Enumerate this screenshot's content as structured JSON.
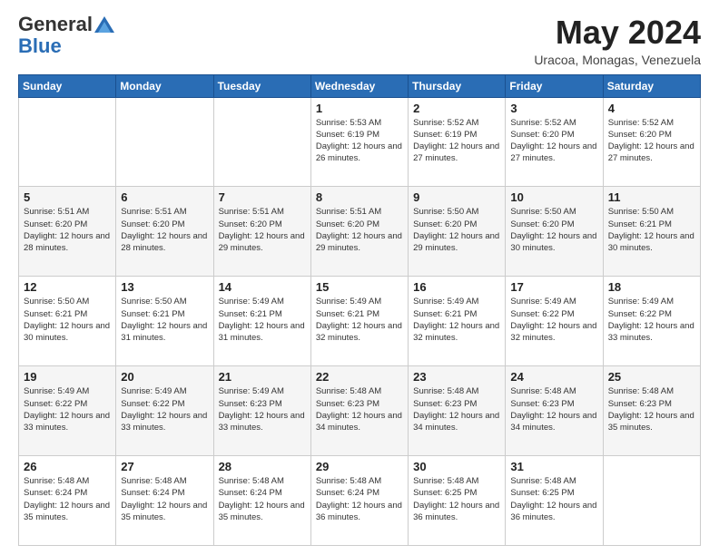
{
  "logo": {
    "general": "General",
    "blue": "Blue"
  },
  "title": {
    "month_year": "May 2024",
    "location": "Uracoa, Monagas, Venezuela"
  },
  "weekdays": [
    "Sunday",
    "Monday",
    "Tuesday",
    "Wednesday",
    "Thursday",
    "Friday",
    "Saturday"
  ],
  "weeks": [
    [
      {
        "day": "",
        "info": ""
      },
      {
        "day": "",
        "info": ""
      },
      {
        "day": "",
        "info": ""
      },
      {
        "day": "1",
        "info": "Sunrise: 5:53 AM\nSunset: 6:19 PM\nDaylight: 12 hours and 26 minutes."
      },
      {
        "day": "2",
        "info": "Sunrise: 5:52 AM\nSunset: 6:19 PM\nDaylight: 12 hours and 27 minutes."
      },
      {
        "day": "3",
        "info": "Sunrise: 5:52 AM\nSunset: 6:20 PM\nDaylight: 12 hours and 27 minutes."
      },
      {
        "day": "4",
        "info": "Sunrise: 5:52 AM\nSunset: 6:20 PM\nDaylight: 12 hours and 27 minutes."
      }
    ],
    [
      {
        "day": "5",
        "info": "Sunrise: 5:51 AM\nSunset: 6:20 PM\nDaylight: 12 hours and 28 minutes."
      },
      {
        "day": "6",
        "info": "Sunrise: 5:51 AM\nSunset: 6:20 PM\nDaylight: 12 hours and 28 minutes."
      },
      {
        "day": "7",
        "info": "Sunrise: 5:51 AM\nSunset: 6:20 PM\nDaylight: 12 hours and 29 minutes."
      },
      {
        "day": "8",
        "info": "Sunrise: 5:51 AM\nSunset: 6:20 PM\nDaylight: 12 hours and 29 minutes."
      },
      {
        "day": "9",
        "info": "Sunrise: 5:50 AM\nSunset: 6:20 PM\nDaylight: 12 hours and 29 minutes."
      },
      {
        "day": "10",
        "info": "Sunrise: 5:50 AM\nSunset: 6:20 PM\nDaylight: 12 hours and 30 minutes."
      },
      {
        "day": "11",
        "info": "Sunrise: 5:50 AM\nSunset: 6:21 PM\nDaylight: 12 hours and 30 minutes."
      }
    ],
    [
      {
        "day": "12",
        "info": "Sunrise: 5:50 AM\nSunset: 6:21 PM\nDaylight: 12 hours and 30 minutes."
      },
      {
        "day": "13",
        "info": "Sunrise: 5:50 AM\nSunset: 6:21 PM\nDaylight: 12 hours and 31 minutes."
      },
      {
        "day": "14",
        "info": "Sunrise: 5:49 AM\nSunset: 6:21 PM\nDaylight: 12 hours and 31 minutes."
      },
      {
        "day": "15",
        "info": "Sunrise: 5:49 AM\nSunset: 6:21 PM\nDaylight: 12 hours and 32 minutes."
      },
      {
        "day": "16",
        "info": "Sunrise: 5:49 AM\nSunset: 6:21 PM\nDaylight: 12 hours and 32 minutes."
      },
      {
        "day": "17",
        "info": "Sunrise: 5:49 AM\nSunset: 6:22 PM\nDaylight: 12 hours and 32 minutes."
      },
      {
        "day": "18",
        "info": "Sunrise: 5:49 AM\nSunset: 6:22 PM\nDaylight: 12 hours and 33 minutes."
      }
    ],
    [
      {
        "day": "19",
        "info": "Sunrise: 5:49 AM\nSunset: 6:22 PM\nDaylight: 12 hours and 33 minutes."
      },
      {
        "day": "20",
        "info": "Sunrise: 5:49 AM\nSunset: 6:22 PM\nDaylight: 12 hours and 33 minutes."
      },
      {
        "day": "21",
        "info": "Sunrise: 5:49 AM\nSunset: 6:23 PM\nDaylight: 12 hours and 33 minutes."
      },
      {
        "day": "22",
        "info": "Sunrise: 5:48 AM\nSunset: 6:23 PM\nDaylight: 12 hours and 34 minutes."
      },
      {
        "day": "23",
        "info": "Sunrise: 5:48 AM\nSunset: 6:23 PM\nDaylight: 12 hours and 34 minutes."
      },
      {
        "day": "24",
        "info": "Sunrise: 5:48 AM\nSunset: 6:23 PM\nDaylight: 12 hours and 34 minutes."
      },
      {
        "day": "25",
        "info": "Sunrise: 5:48 AM\nSunset: 6:23 PM\nDaylight: 12 hours and 35 minutes."
      }
    ],
    [
      {
        "day": "26",
        "info": "Sunrise: 5:48 AM\nSunset: 6:24 PM\nDaylight: 12 hours and 35 minutes."
      },
      {
        "day": "27",
        "info": "Sunrise: 5:48 AM\nSunset: 6:24 PM\nDaylight: 12 hours and 35 minutes."
      },
      {
        "day": "28",
        "info": "Sunrise: 5:48 AM\nSunset: 6:24 PM\nDaylight: 12 hours and 35 minutes."
      },
      {
        "day": "29",
        "info": "Sunrise: 5:48 AM\nSunset: 6:24 PM\nDaylight: 12 hours and 36 minutes."
      },
      {
        "day": "30",
        "info": "Sunrise: 5:48 AM\nSunset: 6:25 PM\nDaylight: 12 hours and 36 minutes."
      },
      {
        "day": "31",
        "info": "Sunrise: 5:48 AM\nSunset: 6:25 PM\nDaylight: 12 hours and 36 minutes."
      },
      {
        "day": "",
        "info": ""
      }
    ]
  ]
}
